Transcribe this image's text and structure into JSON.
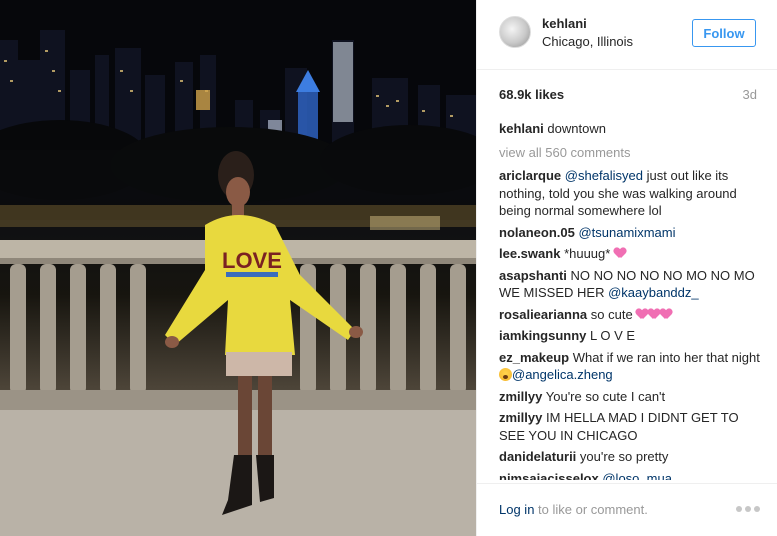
{
  "post": {
    "username": "kehlani",
    "location": "Chicago, Illinois",
    "follow_label": "Follow",
    "likes": "68.9k likes",
    "age": "3d",
    "caption": {
      "user": "kehlani",
      "text": "downtown"
    },
    "view_all": "view all 560 comments",
    "sweater_text": "LOVE"
  },
  "comments": [
    {
      "user": "ariclarque",
      "parts": [
        {
          "t": "mention",
          "v": "@shefalisyed"
        },
        {
          "t": "text",
          "v": " just out like its nothing, told you she was walking around being normal somewhere lol"
        }
      ]
    },
    {
      "user": "nolaneon.05",
      "parts": [
        {
          "t": "mention",
          "v": "@tsunamixmami"
        }
      ]
    },
    {
      "user": "lee.swank",
      "parts": [
        {
          "t": "text",
          "v": "*huuug* "
        },
        {
          "t": "emoji",
          "v": "heart"
        }
      ]
    },
    {
      "user": "asapshanti",
      "parts": [
        {
          "t": "text",
          "v": "NO NO NO NO NO MO NO MO WE MISSED HER "
        },
        {
          "t": "mention",
          "v": "@kaaybanddz_"
        }
      ]
    },
    {
      "user": "rosaliearianna",
      "parts": [
        {
          "t": "text",
          "v": "so cute "
        },
        {
          "t": "emoji",
          "v": "heart"
        },
        {
          "t": "emoji",
          "v": "heart"
        },
        {
          "t": "emoji",
          "v": "heart"
        }
      ]
    },
    {
      "user": "iamkingsunny",
      "parts": [
        {
          "t": "text",
          "v": "L O V E"
        }
      ]
    },
    {
      "user": "ez_makeup",
      "parts": [
        {
          "t": "text",
          "v": "What if we ran into her that night "
        },
        {
          "t": "emoji",
          "v": "face"
        },
        {
          "t": "mention",
          "v": "@angelica.zheng"
        }
      ]
    },
    {
      "user": "zmillyy",
      "parts": [
        {
          "t": "text",
          "v": "You're so cute I can't"
        }
      ]
    },
    {
      "user": "zmillyy",
      "parts": [
        {
          "t": "text",
          "v": "IM HELLA MAD I DIDNT GET TO SEE YOU IN CHICAGO"
        }
      ]
    },
    {
      "user": "danidelaturii",
      "parts": [
        {
          "t": "text",
          "v": "you're so pretty"
        }
      ]
    },
    {
      "user": "nimsaiacisselox",
      "parts": [
        {
          "t": "mention",
          "v": "@loso_mua"
        }
      ]
    }
  ],
  "footer": {
    "login_label": "Log in",
    "login_suffix": " to like or comment."
  },
  "colors": {
    "accent": "#3897f0",
    "mention": "#003569",
    "muted": "#999999"
  },
  "icons": [
    "more-options-icon",
    "avatar"
  ]
}
